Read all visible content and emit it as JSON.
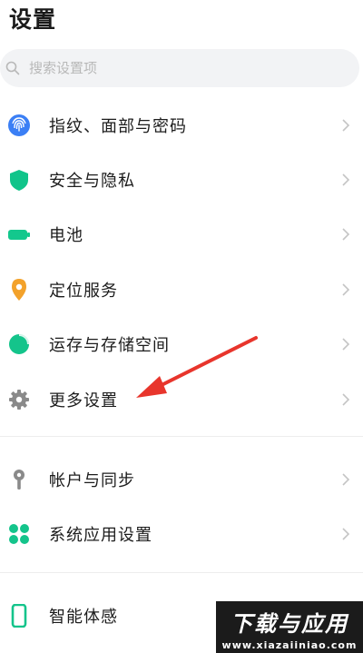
{
  "header": {
    "title": "设置"
  },
  "search": {
    "placeholder": "搜索设置项"
  },
  "menu": [
    {
      "label": "指纹、面部与密码",
      "icon": "fingerprint-icon",
      "color": "#3b7ff5"
    },
    {
      "label": "安全与隐私",
      "icon": "shield-icon",
      "color": "#10c48a"
    },
    {
      "label": "电池",
      "icon": "battery-icon",
      "color": "#13c88d"
    },
    {
      "label": "定位服务",
      "icon": "location-pin-icon",
      "color": "#f3a22b"
    },
    {
      "label": "运存与存储空间",
      "icon": "storage-pie-icon",
      "color": "#14c48b"
    },
    {
      "label": "更多设置",
      "icon": "gear-icon",
      "color": "#8a8a8a"
    },
    {
      "label": "帐户与同步",
      "icon": "key-icon",
      "color": "#8a8a8a"
    },
    {
      "label": "系统应用设置",
      "icon": "apps-grid-icon",
      "color": "#14c48b"
    },
    {
      "label": "智能体感",
      "icon": "phone-icon",
      "color": "#14c48b"
    }
  ],
  "annotation": {
    "arrow_color": "#e8352c"
  },
  "watermark": {
    "title": "下载与应用",
    "url": "www.xiazaiiniao.com"
  }
}
